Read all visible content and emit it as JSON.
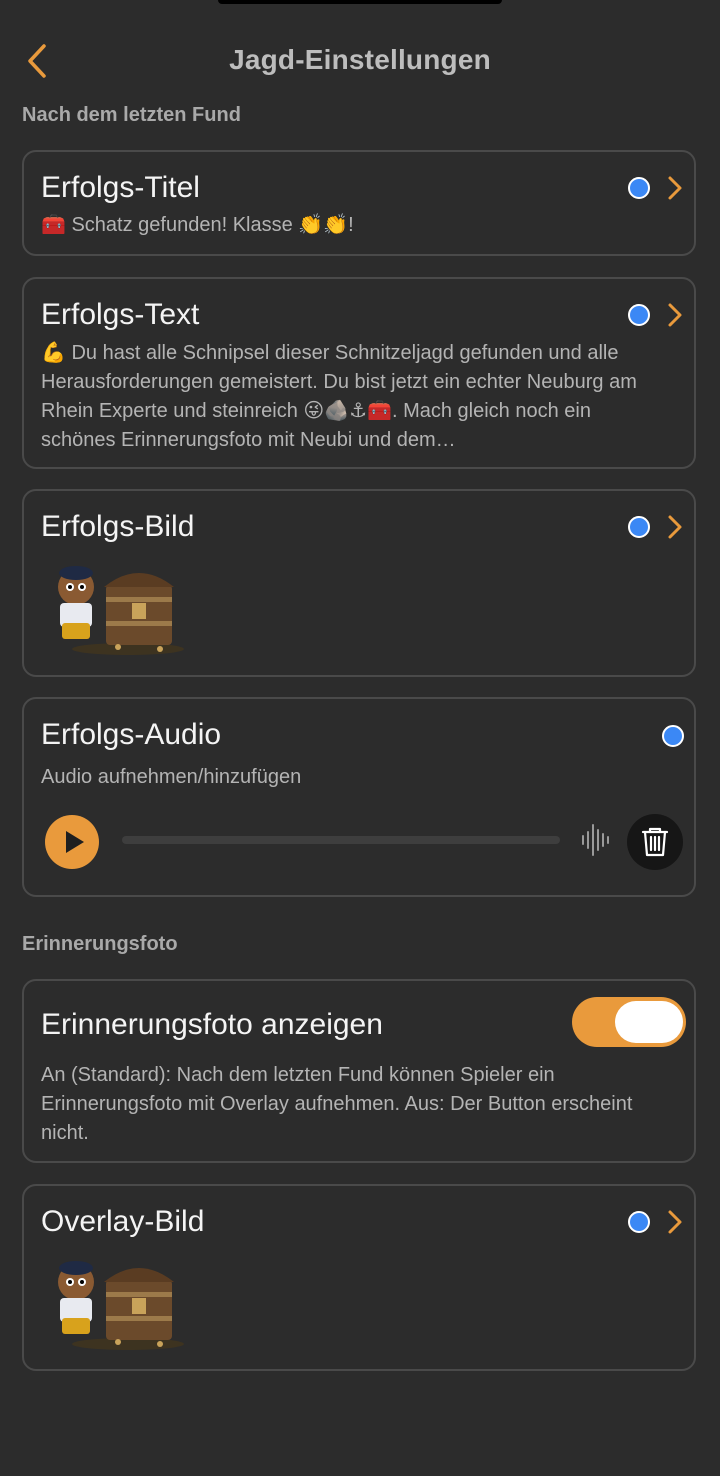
{
  "header": {
    "title": "Jagd-Einstellungen"
  },
  "sections": {
    "after_last_find": "Nach dem letzten Fund",
    "memory_photo": "Erinnerungsfoto"
  },
  "cards": {
    "success_title": {
      "title": "Erfolgs-Titel",
      "value": "🧰 Schatz gefunden! Klasse 👏👏!"
    },
    "success_text": {
      "title": "Erfolgs-Text",
      "value": "💪 Du hast alle Schnipsel dieser Schnitzeljagd gefunden und alle Herausforderungen gemeistert. Du bist jetzt ein echter Neuburg am Rhein Experte und steinreich 😜🪨⚓🧰. Mach gleich noch ein schönes Erinnerungsfoto mit Neubi und dem…"
    },
    "success_image": {
      "title": "Erfolgs-Bild"
    },
    "success_audio": {
      "title": "Erfolgs-Audio",
      "subtitle": "Audio aufnehmen/hinzufügen"
    },
    "memory_photo_toggle": {
      "title": "Erinnerungsfoto anzeigen",
      "description": "An (Standard): Nach dem letzten Fund können Spieler ein Erinnerungsfoto mit Overlay aufnehmen. Aus: Der Button erscheint nicht.",
      "enabled": true
    },
    "overlay_image": {
      "title": "Overlay-Bild"
    }
  },
  "colors": {
    "accent": "#e99a3c",
    "indicator": "#3b88f5",
    "background": "#2c2c2c",
    "card_border": "#4a4a4a"
  },
  "icons": {
    "back": "chevron-left-icon",
    "disclosure": "chevron-right-icon",
    "play": "play-icon",
    "waveform": "waveform-icon",
    "delete": "trash-icon"
  }
}
